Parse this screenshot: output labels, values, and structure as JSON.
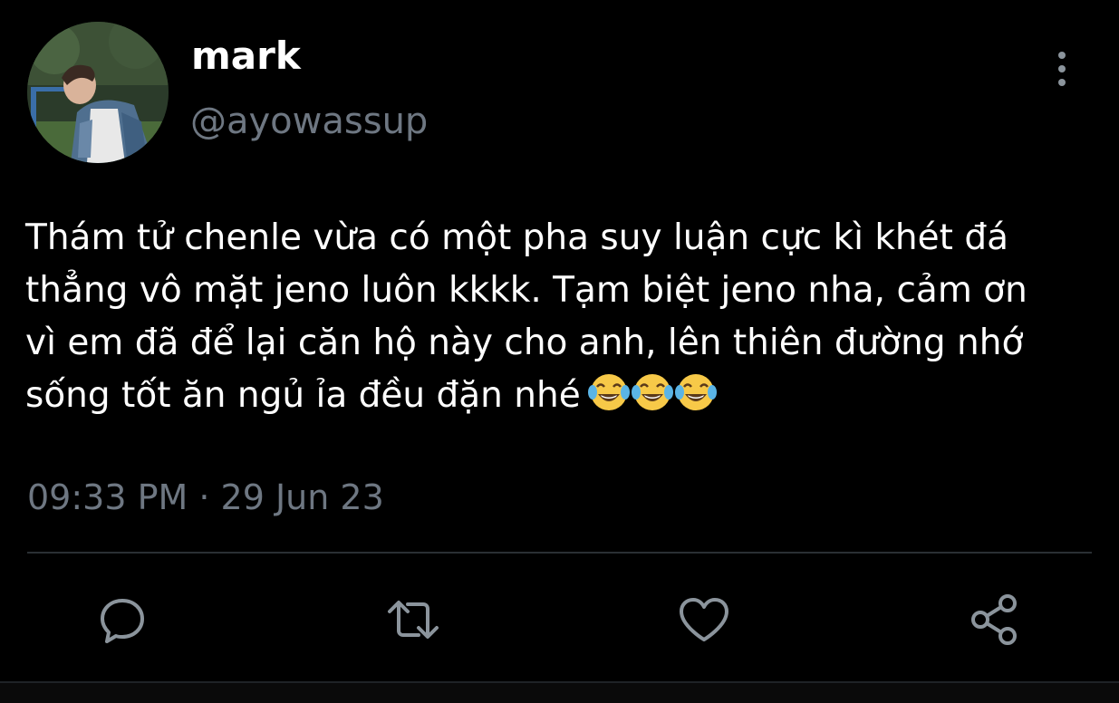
{
  "tweet": {
    "display_name": "mark",
    "handle": "@ayowassup",
    "text": "Thám tử chenle vừa có một pha suy luận cực kì khét đá\nthẳng vô mặt jeno luôn kkkk. Tạm biệt jeno nha, cảm ơn\nvì em đã để lại căn hộ này cho anh, lên thiên đường nhớ\nsống tốt ăn ngủ ỉa đều đặn nhé",
    "emojis": [
      "😂",
      "😂",
      "😂"
    ],
    "timestamp": "09:33 PM · 29 Jun 23"
  },
  "actions": [
    {
      "name": "reply",
      "icon": "comment-icon"
    },
    {
      "name": "retweet",
      "icon": "retweet-icon"
    },
    {
      "name": "like",
      "icon": "heart-icon"
    },
    {
      "name": "share",
      "icon": "share-icon"
    }
  ],
  "colors": {
    "background": "#000000",
    "text": "#ffffff",
    "secondary_text": "#6e7782",
    "icon": "#8b949c",
    "divider": "#2a2f34",
    "emoji_face": "#f7c948"
  }
}
